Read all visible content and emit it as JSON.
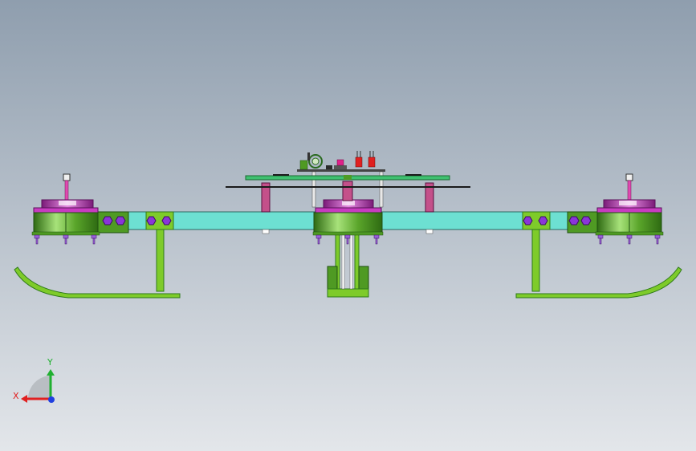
{
  "viewport": {
    "background_top": "#8f9eae",
    "background_bottom": "#e3e6ea"
  },
  "colors": {
    "arm": "#6de0d2",
    "frame_green": "#7ecb2a",
    "frame_dark": "#2f7a1a",
    "motor_green": "#4f9a23",
    "motor_green_light": "#a7e27a",
    "motor_magenta": "#c83cc0",
    "bolt_purple": "#9a62d8",
    "hex_purple": "#8a35d8",
    "board_green": "#3fc070",
    "red": "#e02020",
    "axis_x": "#e02020",
    "axis_y": "#20b030",
    "axis_z": "#2040e0"
  },
  "triad": {
    "x_label": "X",
    "y_label": "Y",
    "icon": "coordinate-triad-icon"
  }
}
